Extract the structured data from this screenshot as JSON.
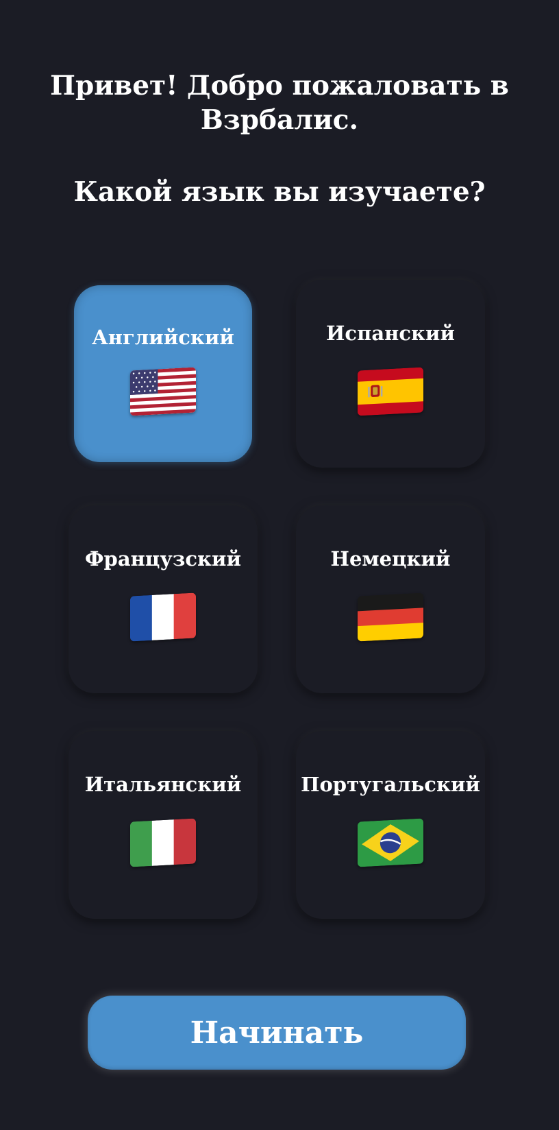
{
  "welcome": {
    "greeting": "Привет! Добро пожаловать в Взрбалис.",
    "question": "Какой язык вы изучаете?"
  },
  "languages": [
    {
      "label": "Английский",
      "flag_icon": "us-flag-icon",
      "selected": true
    },
    {
      "label": "Испанский",
      "flag_icon": "spain-flag-icon",
      "selected": false
    },
    {
      "label": "Французский",
      "flag_icon": "france-flag-icon",
      "selected": false
    },
    {
      "label": "Немецкий",
      "flag_icon": "germany-flag-icon",
      "selected": false
    },
    {
      "label": "Итальянский",
      "flag_icon": "italy-flag-icon",
      "selected": false
    },
    {
      "label": "Португальский",
      "flag_icon": "brazil-flag-icon",
      "selected": false
    }
  ],
  "start_button": {
    "label": "Начинать"
  },
  "colors": {
    "background": "#1b1c25",
    "accent": "#4a90cc",
    "text": "#ffffff"
  }
}
